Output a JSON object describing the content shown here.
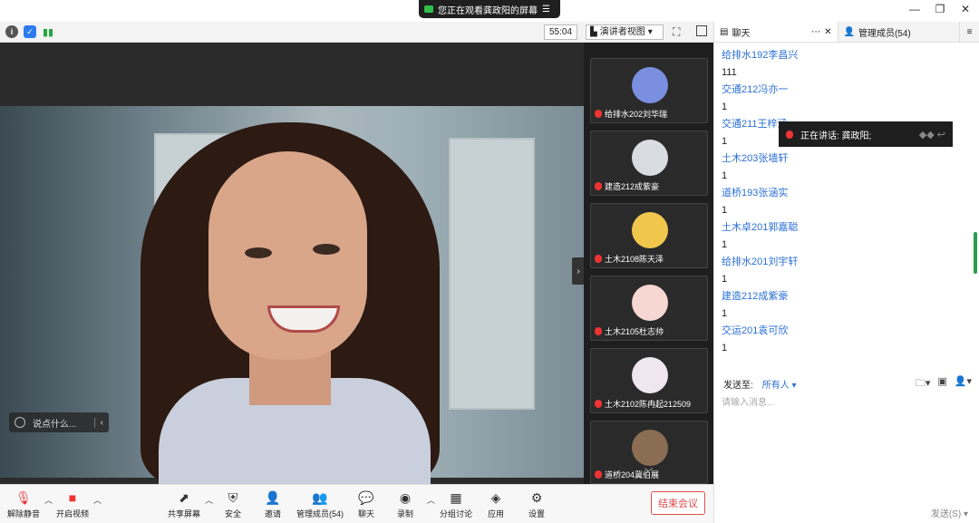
{
  "banner": {
    "text": "您正在观看龚政阳的屏幕"
  },
  "toolbar": {
    "timer": "55:04",
    "view_label": "演讲者视图"
  },
  "video": {
    "say_placeholder": "说点什么..."
  },
  "gallery": {
    "tiles": [
      {
        "name": "给排水202刘华瑞",
        "color": "#7a8fe0"
      },
      {
        "name": "建造212成紫豪",
        "color": "#d9dde2"
      },
      {
        "name": "土木2108陈天泽",
        "color": "#f1c64d"
      },
      {
        "name": "土木2105杜志帅",
        "color": "#f6d7d1"
      },
      {
        "name": "土木2102陈冉起212509",
        "color": "#efe6ef"
      },
      {
        "name": "道桥204冀伯展",
        "color": "#8a6d52"
      }
    ]
  },
  "bottom": {
    "unmute": "解除静音",
    "start_video": "开启视频",
    "share_screen": "共享屏幕",
    "security": "安全",
    "invite": "邀请",
    "manage_members": "管理成员(54)",
    "chat": "聊天",
    "record": "录制",
    "breakout": "分组讨论",
    "apps": "应用",
    "settings": "设置",
    "end_meeting": "结束会议"
  },
  "chat": {
    "tab_chat": "聊天",
    "tab_members": "管理成员(54)",
    "messages": [
      {
        "sender": "给排水192李昌兴",
        "text": "111"
      },
      {
        "sender": "交通212冯亦一",
        "text": "1"
      },
      {
        "sender": "交通211王梓涵",
        "text": "1"
      },
      {
        "sender": "土木203张墙轩",
        "text": "1"
      },
      {
        "sender": "道桥193张涵实",
        "text": "1"
      },
      {
        "sender": "土木卓201郭嘉聪",
        "text": "1"
      },
      {
        "sender": "给排水201刘宇轩",
        "text": "1"
      },
      {
        "sender": "建造212成紫豪",
        "text": "1"
      },
      {
        "sender": "交运201袁可欣",
        "text": "1"
      }
    ],
    "speaking": "正在讲话: 龚政阳;",
    "send_to_label": "发送至:",
    "send_to_target": "所有人",
    "input_placeholder": "请输入消息...",
    "send_button": "发送(S)"
  }
}
